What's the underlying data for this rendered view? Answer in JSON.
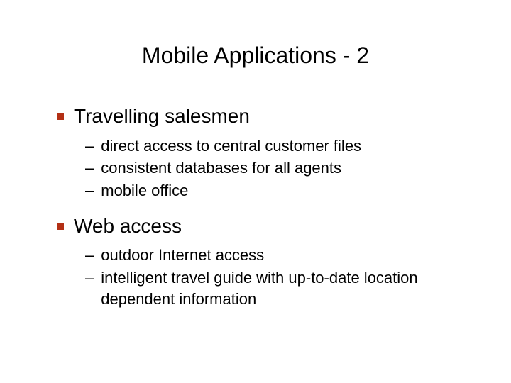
{
  "title": "Mobile Applications - 2",
  "sections": [
    {
      "heading": "Travelling salesmen",
      "items": [
        "direct access to central customer files",
        "consistent databases for all agents",
        "mobile office"
      ]
    },
    {
      "heading": "Web access",
      "items": [
        "outdoor Internet access",
        "intelligent travel guide with up-to-date location dependent information"
      ]
    }
  ]
}
